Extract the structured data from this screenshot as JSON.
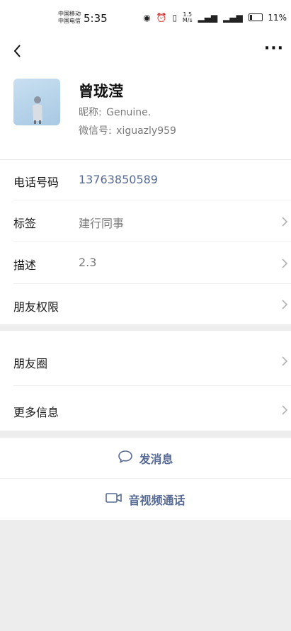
{
  "status_bar": {
    "carrier_1": "中国移动",
    "carrier_2": "中国电信",
    "time": "5:35",
    "net_speed_value": "1.5",
    "net_speed_unit": "M/s",
    "signal_1": "⁴⁶",
    "signal_2": "⁵ᴳ",
    "battery": "11%"
  },
  "header": {
    "back_icon": "back-chevron-icon",
    "more_icon": "more-dots-icon"
  },
  "profile": {
    "name": "曾珑滢",
    "nickname_label": "昵称:",
    "nickname": "Genuine.",
    "wechat_id_label": "微信号:",
    "wechat_id": "xiguazly959"
  },
  "details": {
    "phone_label": "电话号码",
    "phone": "13763850589",
    "tags_label": "标签",
    "tags": "建行同事",
    "desc_label": "描述",
    "desc": "2.3",
    "permissions_label": "朋友权限"
  },
  "more_section": {
    "moments_label": "朋友圈",
    "more_info_label": "更多信息"
  },
  "actions": {
    "message_label": "发消息",
    "call_label": "音视频通话"
  },
  "colors": {
    "link": "#576b95",
    "background": "#ededed",
    "card": "#ffffff"
  }
}
